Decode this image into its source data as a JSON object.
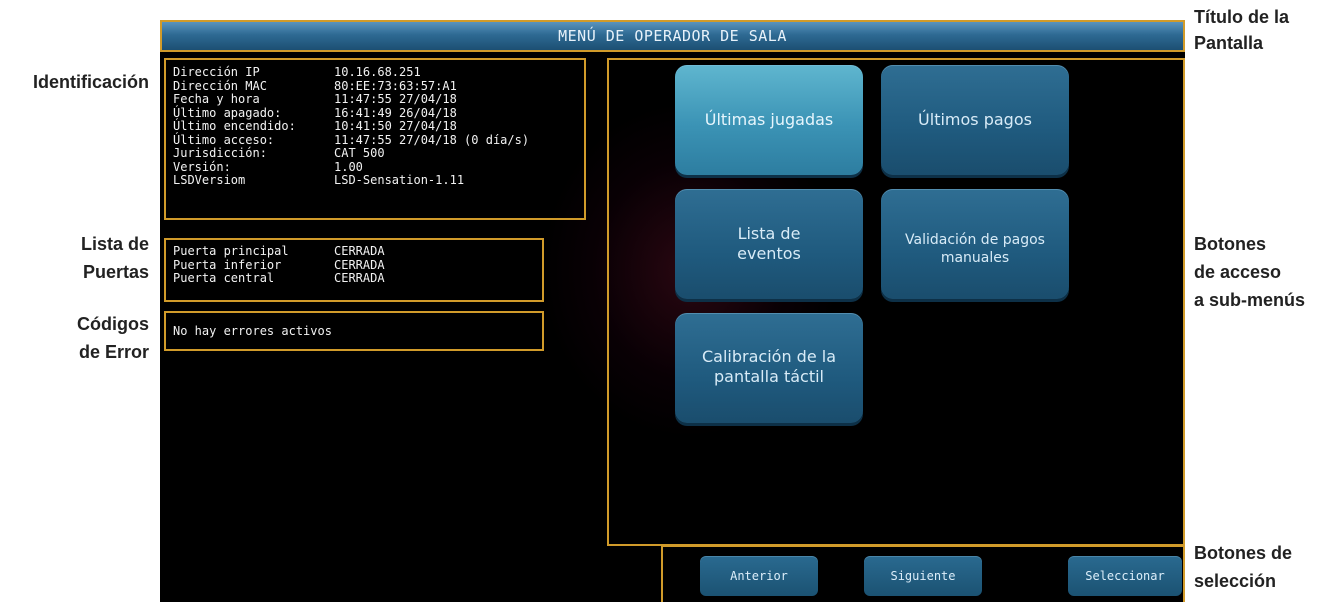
{
  "screen": {
    "title": "MENÚ DE OPERADOR DE SALA"
  },
  "identification": {
    "rows": [
      {
        "label": "Dirección IP",
        "value": "10.16.68.251"
      },
      {
        "label": "Dirección MAC",
        "value": "80:EE:73:63:57:A1"
      },
      {
        "label": "Fecha y hora",
        "value": "11:47:55 27/04/18"
      },
      {
        "label": "Último apagado:",
        "value": "16:41:49 26/04/18"
      },
      {
        "label": "Último encendido:",
        "value": "10:41:50 27/04/18"
      },
      {
        "label": "Último acceso:",
        "value": "11:47:55 27/04/18 (0 día/s)"
      },
      {
        "label": "Jurisdicción:",
        "value": "CAT 500"
      },
      {
        "label": "Versión:",
        "value": "1.00"
      },
      {
        "label": "LSDVersiom",
        "value": "LSD-Sensation-1.11"
      }
    ]
  },
  "doors": {
    "rows": [
      {
        "label": "Puerta principal",
        "value": "CERRADA"
      },
      {
        "label": "Puerta inferior",
        "value": "CERRADA"
      },
      {
        "label": "Puerta central",
        "value": "CERRADA"
      }
    ]
  },
  "errors": {
    "text": "No hay errores activos"
  },
  "menu": {
    "buttons": [
      {
        "line1": "Últimas jugadas",
        "line2": ""
      },
      {
        "line1": "Últimos pagos",
        "line2": ""
      },
      {
        "line1": "Lista de",
        "line2": "eventos"
      },
      {
        "line1": "Validación de pagos",
        "line2": "manuales"
      },
      {
        "line1": "Calibración de la",
        "line2": "pantalla táctil"
      }
    ]
  },
  "nav": {
    "prev": "Anterior",
    "next": "Siguiente",
    "select": "Seleccionar"
  },
  "annotations": {
    "identificacion": "Identificación",
    "lista_puertas_1": "Lista de",
    "lista_puertas_2": "Puertas",
    "codigos_1": "Códigos",
    "codigos_2": "de Error",
    "titulo_1": "Título de la",
    "titulo_2": "Pantalla",
    "botones_1": "Botones",
    "botones_2": "de acceso",
    "botones_3": "a sub-menús",
    "seleccion_1": "Botones de",
    "seleccion_2": "selección"
  },
  "colors": {
    "annotation_border": "#d19b2a",
    "button_blue": "#1f5a7e",
    "button_active": "#3b93b5"
  }
}
